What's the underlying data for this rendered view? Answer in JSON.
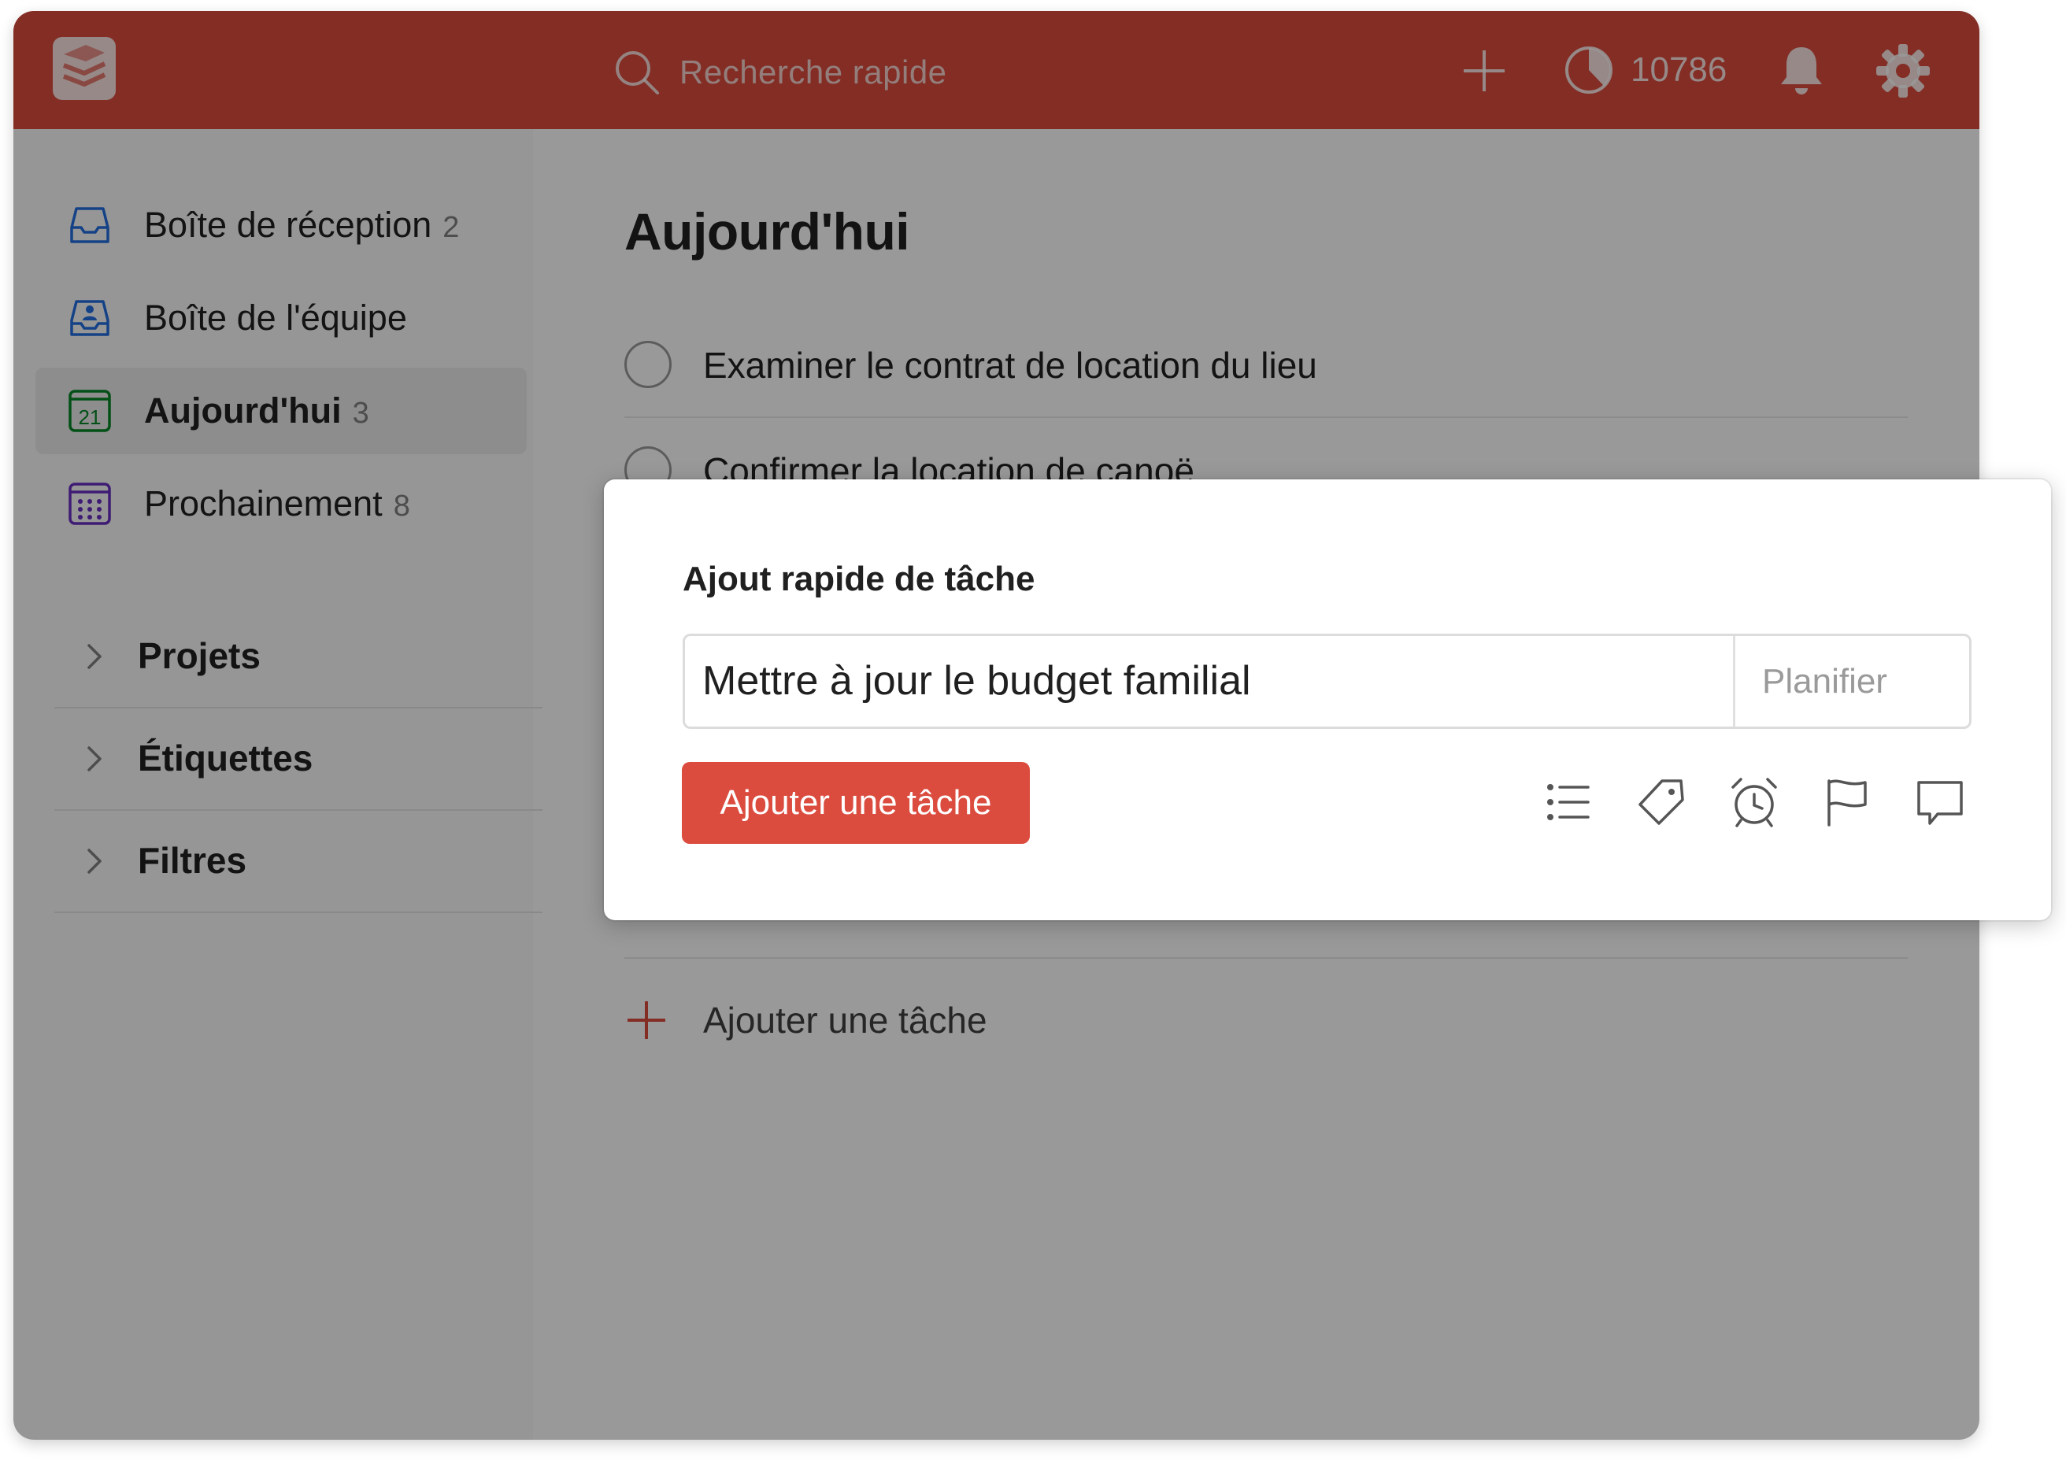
{
  "app": {
    "search": {
      "placeholder": "Recherche rapide"
    },
    "karma": {
      "value": "10786"
    },
    "colors": {
      "brand": "#db4c3f",
      "today_icon": "#058527",
      "inbox_icon": "#246fe0",
      "upcoming_icon": "#692fc2"
    }
  },
  "sidebar": {
    "items": [
      {
        "label": "Boîte de réception",
        "count": "2",
        "icon": "inbox-icon"
      },
      {
        "label": "Boîte de l'équipe",
        "count": "",
        "icon": "team-inbox-icon"
      },
      {
        "label": "Aujourd'hui",
        "count": "3",
        "icon": "today-calendar-icon",
        "active": true
      },
      {
        "label": "Prochainement",
        "count": "8",
        "icon": "upcoming-calendar-icon"
      }
    ],
    "today_day": "21",
    "sections": [
      {
        "label": "Projets"
      },
      {
        "label": "Étiquettes"
      },
      {
        "label": "Filtres"
      }
    ]
  },
  "main": {
    "title": "Aujourd'hui",
    "tasks": [
      {
        "text": "Examiner le contrat de location du lieu"
      },
      {
        "text": "Confirmer la location de canoë"
      }
    ],
    "add_task_label": "Ajouter une tâche"
  },
  "quick_add": {
    "title": "Ajout rapide de tâche",
    "input_value": "Mettre à jour le budget familial",
    "schedule_label": "Planifier",
    "submit_label": "Ajouter une tâche",
    "tools": [
      "list-icon",
      "label-tag-icon",
      "reminder-alarm-icon",
      "priority-flag-icon",
      "comment-icon"
    ]
  }
}
